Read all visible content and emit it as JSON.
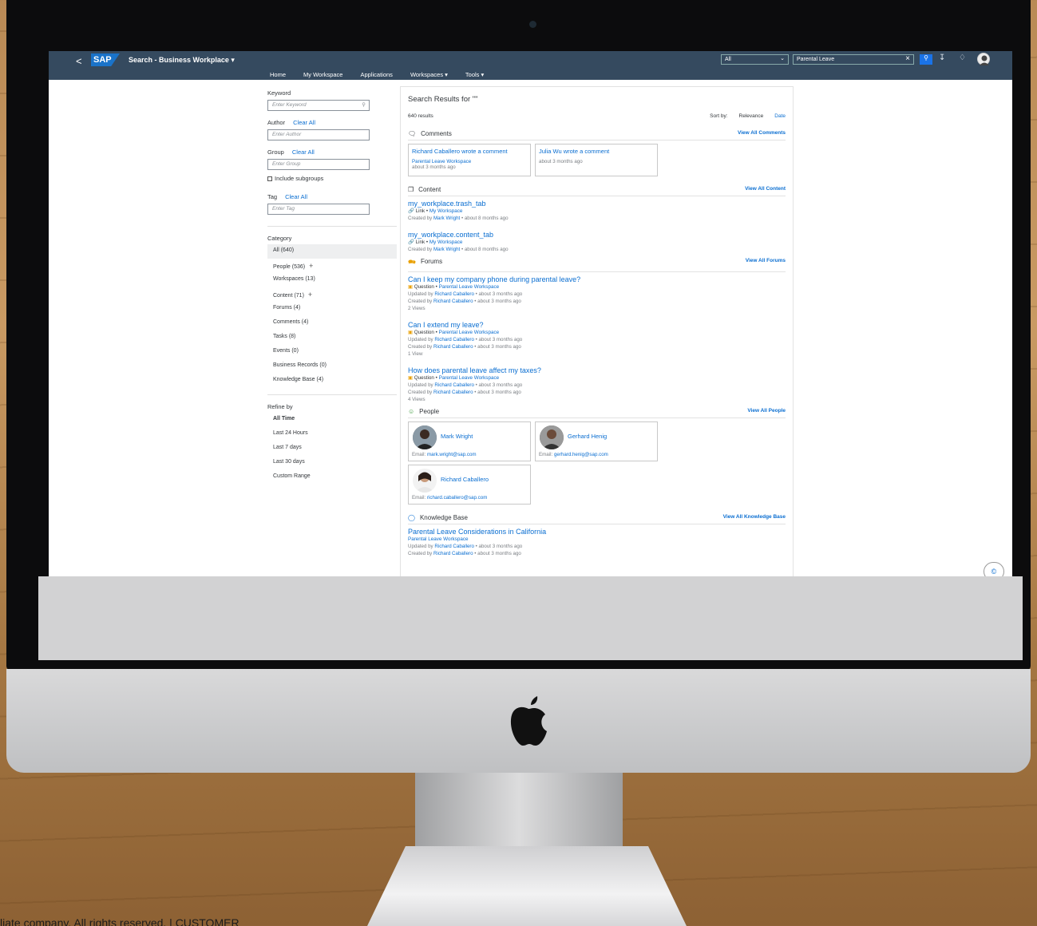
{
  "shell": {
    "back": "<",
    "logo": "SAP",
    "title": "Search - Business Workplace ▾",
    "nav": [
      "Home",
      "My Workspace",
      "Applications",
      "Workspaces ▾",
      "Tools ▾"
    ],
    "scope": "All",
    "query": "Parental Leave",
    "search_icon": "search-icon"
  },
  "facets": {
    "keyword_label": "Keyword",
    "keyword_placeholder": "Enter Keyword",
    "author_label": "Author",
    "author_placeholder": "Enter Author",
    "group_label": "Group",
    "group_placeholder": "Enter Group",
    "include_subgroups": "Include subgroups",
    "tag_label": "Tag",
    "tag_placeholder": "Enter Tag",
    "clear_all": "Clear All",
    "category_label": "Category",
    "categories": [
      "All (640)",
      "People (536)",
      "Workspaces (13)",
      "Content (71)",
      "Forums (4)",
      "Comments (4)",
      "Tasks (8)",
      "Events (0)",
      "Business Records (0)",
      "Knowledge Base (4)"
    ],
    "refine_label": "Refine by",
    "refine": [
      "All Time",
      "Last 24 Hours",
      "Last 7 days",
      "Last 30 days",
      "Custom Range"
    ]
  },
  "results": {
    "title": "Search Results for \"\"",
    "count": "640 results",
    "sort_label": "Sort by:",
    "sort_relevance": "Relevance",
    "sort_date": "Date",
    "comments": {
      "title": "Comments",
      "view_all": "View All Comments",
      "cards": [
        {
          "title": "Richard Caballero wrote a comment",
          "ws": "Parental Leave Workspace",
          "time": "about 3 months ago"
        },
        {
          "title": "Julia Wu wrote a comment",
          "ws": "",
          "time": "about 3 months ago"
        }
      ]
    },
    "content": {
      "title": "Content",
      "view_all": "View All Content",
      "items": [
        {
          "title": "my_workplace.trash_tab",
          "type": "Link",
          "ws": "My Workspace",
          "created_by": "Mark Wright",
          "time": "about 8 months ago"
        },
        {
          "title": "my_workplace.content_tab",
          "type": "Link",
          "ws": "My Workspace",
          "created_by": "Mark Wright",
          "time": "about 8 months ago"
        }
      ]
    },
    "forums": {
      "title": "Forums",
      "view_all": "View All Forums",
      "items": [
        {
          "title": "Can I keep my company phone during parental leave?",
          "type": "Question",
          "ws": "Parental Leave Workspace",
          "updated_by": "Richard Caballero",
          "created_by": "Richard Caballero",
          "time": "about 3 months ago",
          "views": "2 Views"
        },
        {
          "title": "Can I extend my leave?",
          "type": "Question",
          "ws": "Parental Leave Workspace",
          "updated_by": "Richard Caballero",
          "created_by": "Richard Caballero",
          "time": "about 3 months ago",
          "views": "1 View"
        },
        {
          "title": "How does parental leave affect my taxes?",
          "type": "Question",
          "ws": "Parental Leave Workspace",
          "updated_by": "Richard Caballero",
          "created_by": "Richard Caballero",
          "time": "about 3 months ago",
          "views": "4 Views"
        }
      ]
    },
    "people": {
      "title": "People",
      "view_all": "View All People",
      "cards": [
        {
          "name": "Mark Wright",
          "email": "mark.wright@sap.com"
        },
        {
          "name": "Gerhard Henig",
          "email": "gerhard.henig@sap.com"
        },
        {
          "name": "Richard Caballero",
          "email": "richard.caballero@sap.com"
        }
      ]
    },
    "kb": {
      "title": "Knowledge Base",
      "view_all": "View All Knowledge Base",
      "items": [
        {
          "title": "Parental Leave Considerations in California",
          "ws": "Parental Leave Workspace",
          "updated_by": "Richard Caballero",
          "created_by": "Richard Caballero",
          "time": "about 3 months ago"
        }
      ]
    }
  },
  "labels": {
    "updated_by": "Updated by",
    "created_by": "Created by",
    "email": "Email:",
    "sep": " • "
  },
  "footer_note": "liate company. All rights reserved.  |  CUSTOMER"
}
